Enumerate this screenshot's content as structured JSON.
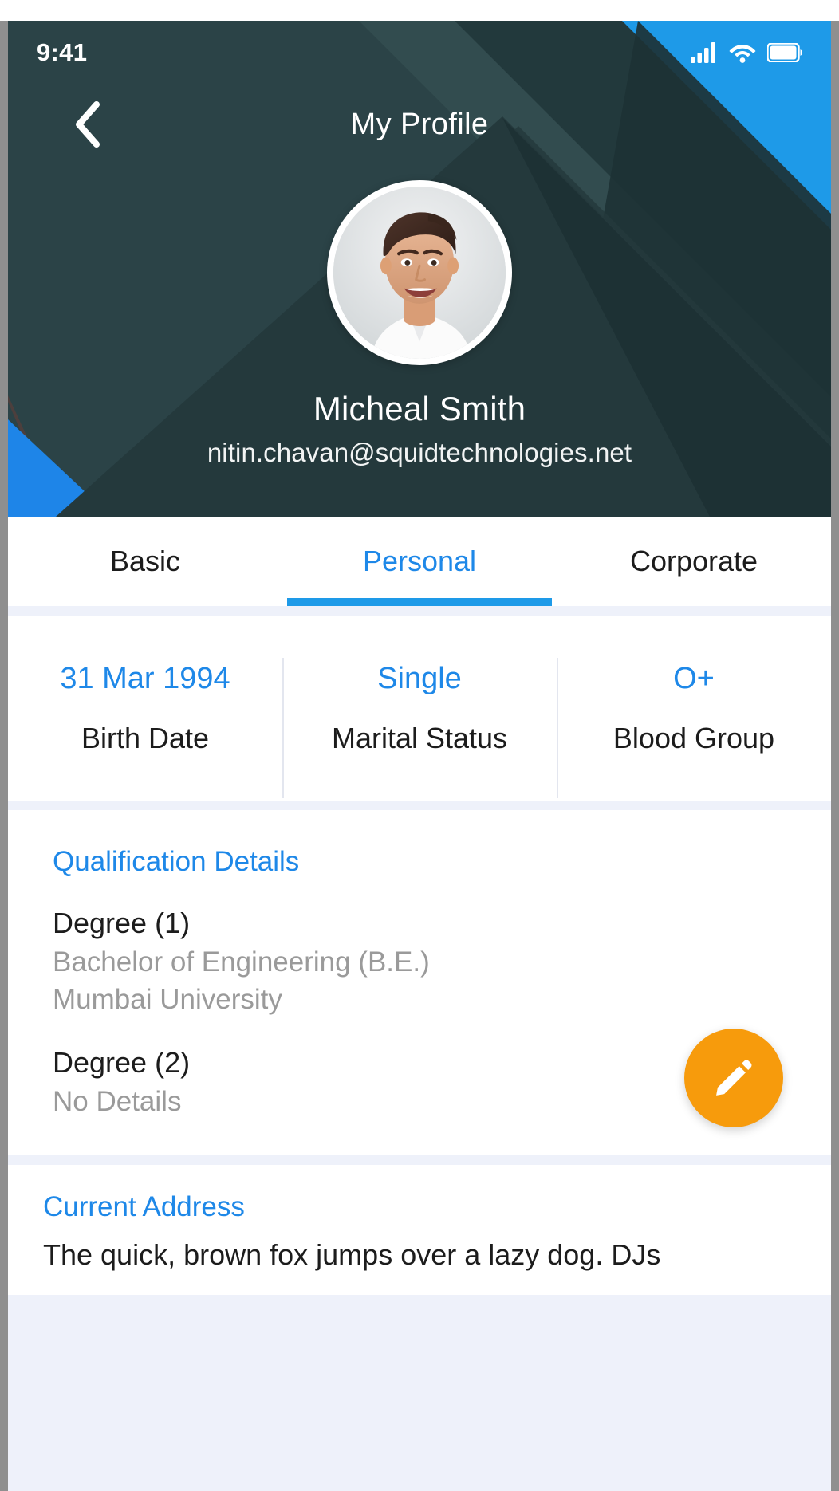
{
  "status_bar": {
    "time": "9:41",
    "signal_icon": "signal-bars-icon",
    "wifi_icon": "wifi-icon",
    "battery_icon": "battery-full-icon"
  },
  "header": {
    "back_icon": "chevron-left-icon",
    "title": "My Profile",
    "avatar_alt": "profile-photo",
    "name": "Micheal Smith",
    "email": "nitin.chavan@squidtechnologies.net",
    "bg_teal": "#2b4347",
    "bg_teal_dark": "#1f3336",
    "bg_teal_light": "#3a5457",
    "accent_blue": "#1e88e8"
  },
  "tabs": [
    {
      "label": "Basic",
      "active": false
    },
    {
      "label": "Personal",
      "active": true
    },
    {
      "label": "Corporate",
      "active": false
    }
  ],
  "stats": [
    {
      "value": "31 Mar 1994",
      "label": "Birth Date"
    },
    {
      "value": "Single",
      "label": "Marital Status"
    },
    {
      "value": "O+",
      "label": "Blood Group"
    }
  ],
  "qualification": {
    "title": "Qualification Details",
    "degrees": [
      {
        "label": "Degree (1)",
        "line1": "Bachelor of Engineering (B.E.)",
        "line2": "Mumbai University"
      },
      {
        "label": "Degree (2)",
        "line1": "No Details",
        "line2": ""
      }
    ]
  },
  "address": {
    "title": "Current Address",
    "text": "The quick, brown fox jumps over a lazy dog. DJs"
  },
  "fab": {
    "icon": "pencil-edit-icon",
    "color": "#f79b0c"
  }
}
